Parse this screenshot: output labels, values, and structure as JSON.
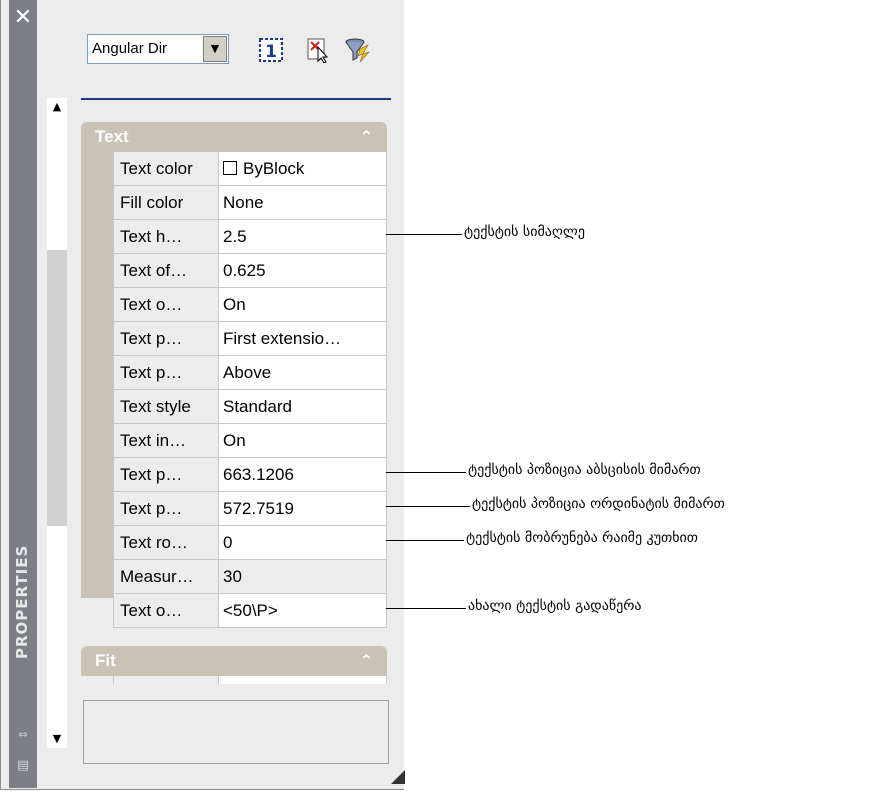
{
  "palette": {
    "title": "PROPERTIES",
    "selection_dropdown": "Angular Dir",
    "toolbar": {
      "toggle_pickadd_icon": "pickadd-1-icon",
      "select_objects_icon": "select-objects-icon",
      "quick_select_icon": "quick-select-funnel-icon"
    },
    "categories": [
      {
        "label": "Text",
        "collapse_glyph": "⌃",
        "rows": [
          {
            "name": "Text color",
            "value": "ByBlock",
            "swatch": true
          },
          {
            "name": "Fill color",
            "value": "None"
          },
          {
            "name": "Text h…",
            "value": "2.5"
          },
          {
            "name": "Text of…",
            "value": "0.625"
          },
          {
            "name": "Text o…",
            "value": "On"
          },
          {
            "name": "Text p…",
            "value": "First extensio…"
          },
          {
            "name": "Text p…",
            "value": "Above"
          },
          {
            "name": "Text style",
            "value": "Standard"
          },
          {
            "name": "Text in…",
            "value": "On"
          },
          {
            "name": "Text p…",
            "value": "663.1206"
          },
          {
            "name": "Text p…",
            "value": "572.7519"
          },
          {
            "name": "Text ro…",
            "value": "0"
          },
          {
            "name": "Measur…",
            "value": "30",
            "readonly": true
          },
          {
            "name": "Text o…",
            "value": "<50\\P>"
          }
        ]
      },
      {
        "label": "Fit",
        "collapse_glyph": "⌃"
      }
    ]
  },
  "callouts": [
    {
      "text": "ტექსტის სიმაღლე"
    },
    {
      "text": "ტექსტის პოზიცია აბსცისის მიმართ"
    },
    {
      "text": "ტექსტის პოზიცია ორდინატის მიმართ"
    },
    {
      "text": "ტექსტის მობრუნება რაიმე კუთხით"
    },
    {
      "text": "ახალი ტექსტის გადაწერა"
    }
  ],
  "colors": {
    "category_header": "#c9c3b6",
    "titlebar": "#7d7f86",
    "divider": "#1f3a7a"
  }
}
